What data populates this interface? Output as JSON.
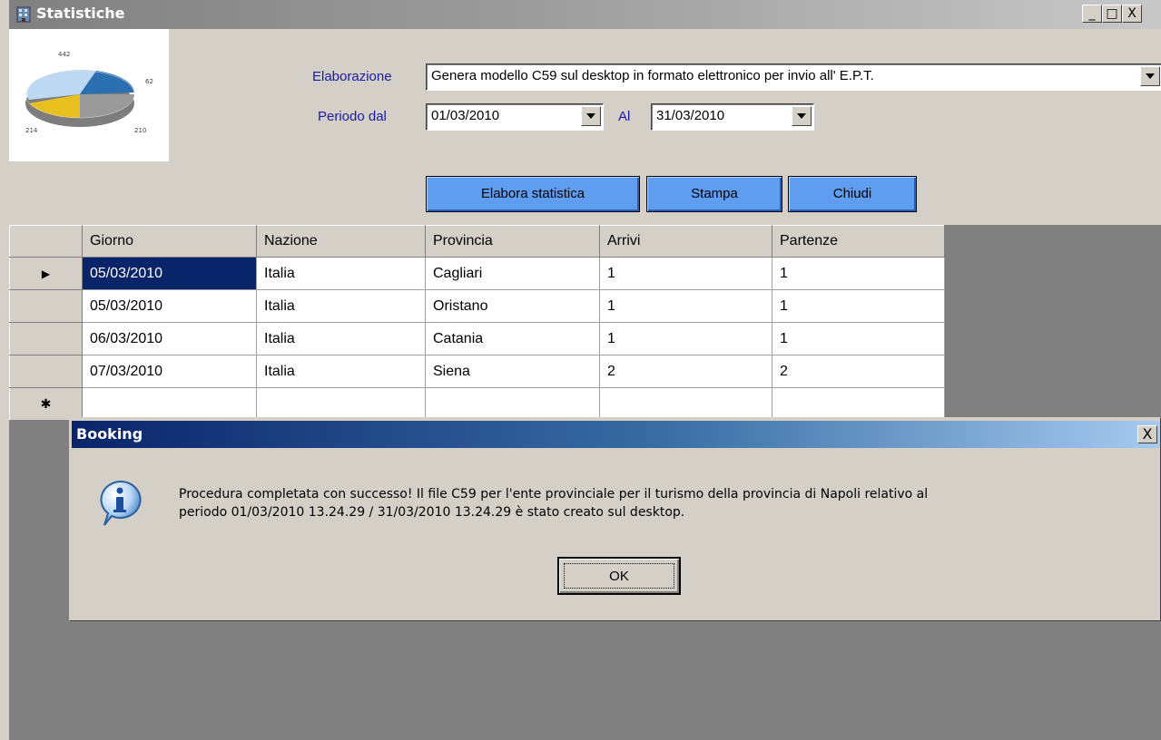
{
  "window": {
    "title": "Statistiche",
    "controls": [
      "_",
      "□",
      "X"
    ]
  },
  "form": {
    "elaborazione_label": "Elaborazione",
    "elaborazione_value": "Genera modello C59 sul desktop in formato elettronico per invio all' E.P.T.",
    "periodo_label": "Periodo dal",
    "date_from": "01/03/2010",
    "al_label": "Al",
    "date_to": "31/03/2010"
  },
  "buttons": {
    "elabora": "Elabora statistica",
    "stampa": "Stampa",
    "chiudi": "Chiudi"
  },
  "logo_chart": {
    "labels": [
      "442",
      "62",
      "210",
      "214"
    ]
  },
  "grid": {
    "columns": [
      "Giorno",
      "Nazione",
      "Provincia",
      "Arrivi",
      "Partenze"
    ],
    "rows": [
      [
        "05/03/2010",
        "Italia",
        "Cagliari",
        "1",
        "1"
      ],
      [
        "05/03/2010",
        "Italia",
        "Oristano",
        "1",
        "1"
      ],
      [
        "06/03/2010",
        "Italia",
        "Catania",
        "1",
        "1"
      ],
      [
        "07/03/2010",
        "Italia",
        "Siena",
        "2",
        "2"
      ]
    ],
    "current_row_marker": "▶",
    "new_row_marker": "✱"
  },
  "dialog": {
    "title": "Booking",
    "close": "X",
    "line1": "Procedura completata con successo! Il file C59 per l'ente provinciale per il turismo della provincia di Napoli  relativo al",
    "line2": "periodo 01/03/2010 13.24.29 / 31/03/2010 13.24.29 è stato creato sul desktop.",
    "ok": "OK",
    "icon": "info-icon"
  },
  "colors": {
    "button_blue": "#5f9df0",
    "label_blue": "#1a1aa8",
    "selection": "#0a246a"
  }
}
